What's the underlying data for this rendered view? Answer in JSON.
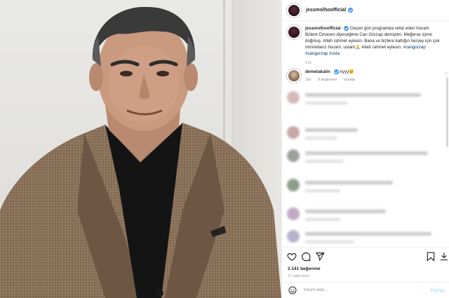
{
  "post": {
    "username": "jessmolhoofficial",
    "caption_text": "Geçen gün programda vefat eden hocam Bülent Özveren diyeceğime Can Gürzap demiştim. Meğerse içime doğmuş. Allah rahmet eylesin. Bana ve bizlere kattığın herşey için çok minnettarız hocam, ustam🙏 Allah rahmet eylesin.",
    "hashtags": "#cangürzap #cangurzap #usta",
    "caption_age": "17s",
    "reply": {
      "username": "demetakalin",
      "text": "Ayyy😢",
      "age": "16s",
      "likes": "8 beğenme",
      "reply_label": "Yanıtla"
    },
    "likes_count": "2.141 beğenme",
    "posted_ago": "17 saat önce",
    "comment_placeholder": "Yorum ekle...",
    "share_label": "Paylaş"
  },
  "icons": {
    "like": "heart-icon",
    "comment": "comment-icon",
    "share": "send-icon",
    "save": "bookmark-icon",
    "emoji": "emoji-icon"
  }
}
